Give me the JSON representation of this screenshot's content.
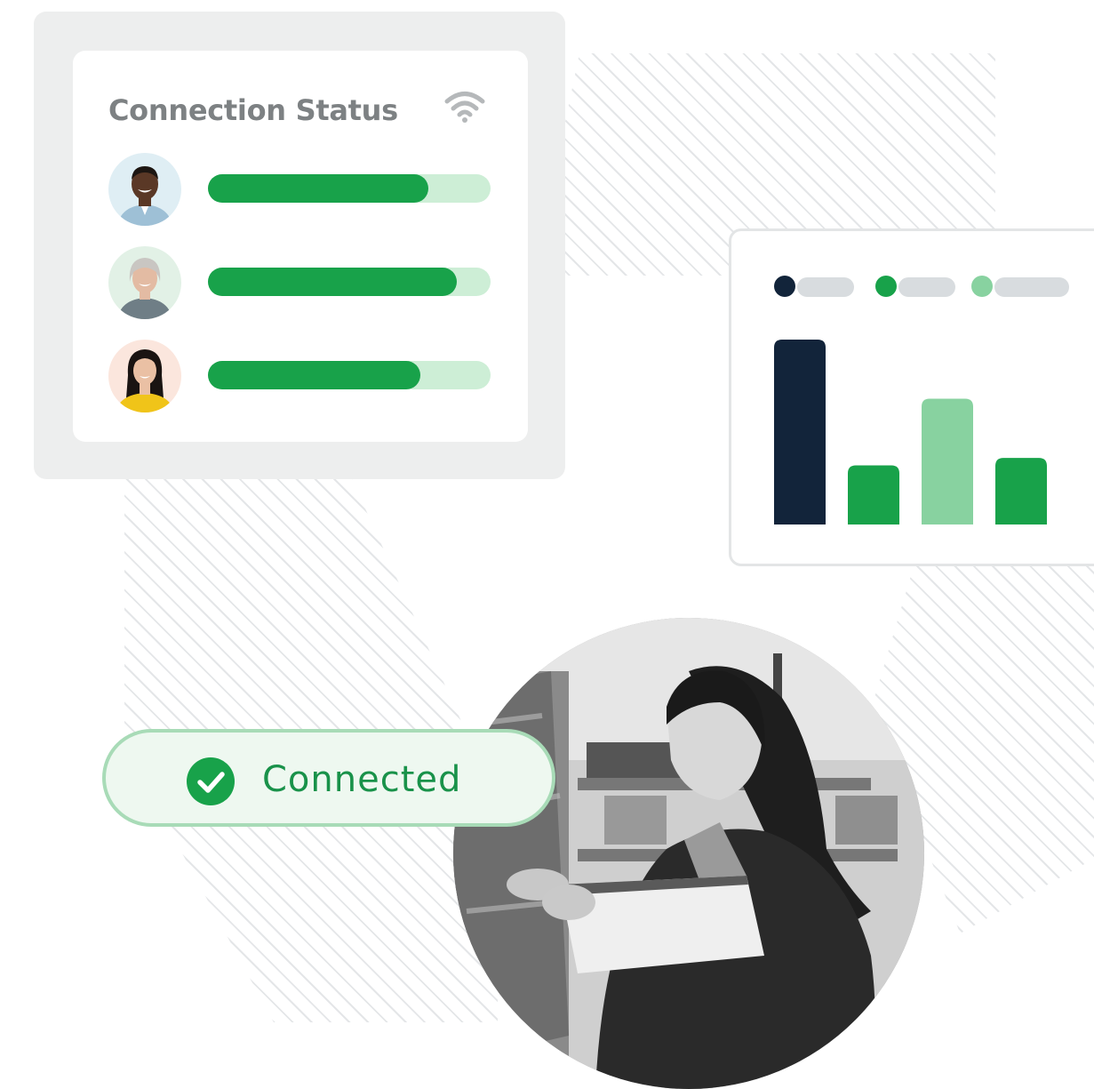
{
  "connection_card": {
    "title": "Connection Status",
    "icon": "wifi-icon",
    "users": [
      {
        "avatar": "avatar-man-smiling",
        "progress": 0.78,
        "skin": "#5a3826",
        "bg": "#dfeef4",
        "shirt": "#9ec0d6",
        "hair": "#1d1612"
      },
      {
        "avatar": "avatar-older-woman",
        "progress": 0.88,
        "skin": "#e3bba3",
        "bg": "#e2f1e6",
        "shirt": "#6f7e86",
        "hair": "#c9c6c2"
      },
      {
        "avatar": "avatar-young-woman",
        "progress": 0.75,
        "skin": "#eac0a4",
        "bg": "#fbe6dd",
        "shirt": "#f0c419",
        "hair": "#1a1412"
      }
    ]
  },
  "chart_data": {
    "type": "bar",
    "categories": [
      "",
      "",
      "",
      ""
    ],
    "values": [
      100,
      32,
      68,
      36
    ],
    "ylim": [
      0,
      100
    ],
    "colors": [
      "#12243a",
      "#18a24a",
      "#88d2a0",
      "#18a24a"
    ],
    "legend": [
      {
        "color": "#12243a"
      },
      {
        "color": "#18a24a"
      },
      {
        "color": "#88d2a0"
      }
    ],
    "grid": false,
    "legend_placement": "top-left"
  },
  "status_pill": {
    "label": "Connected",
    "icon": "check-circle-icon",
    "color": "#19924a"
  },
  "photo": {
    "subject": "woman-reading-tablet-in-warehouse"
  },
  "colors": {
    "accent": "#18a24a",
    "accent_light": "#cdeed6",
    "navy": "#12243a"
  }
}
